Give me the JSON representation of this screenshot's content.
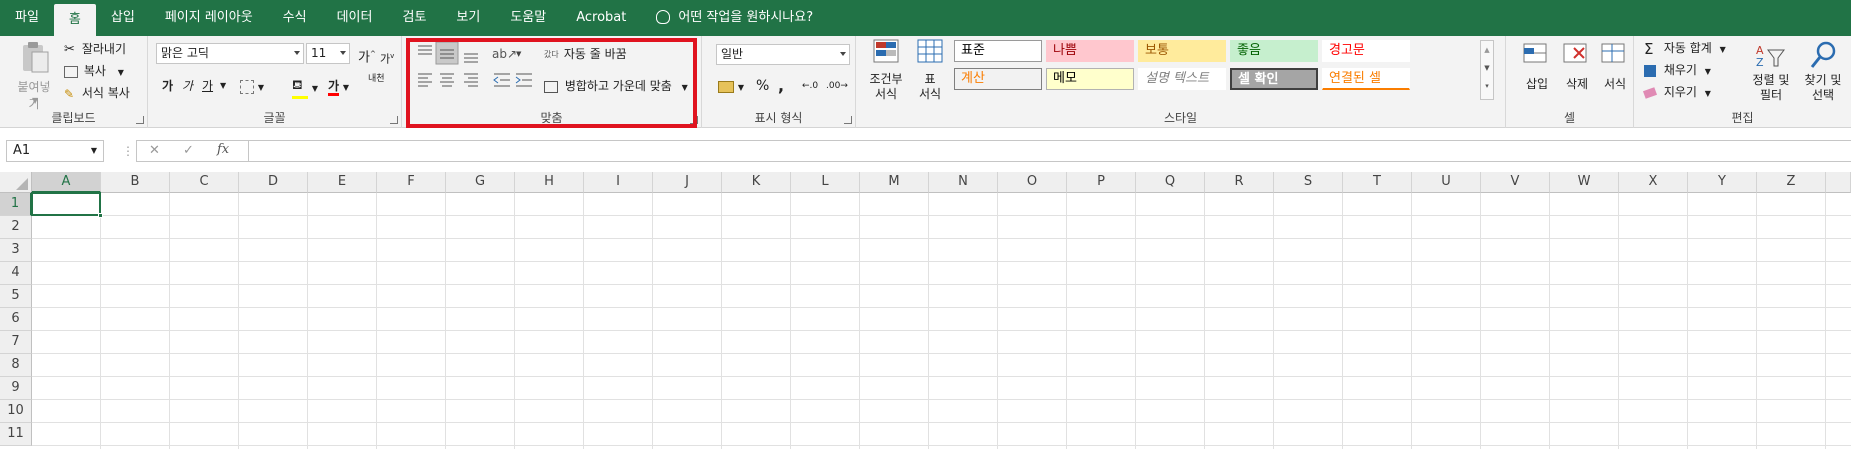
{
  "tabs": [
    "파일",
    "홈",
    "삽입",
    "페이지 레이아웃",
    "수식",
    "데이터",
    "검토",
    "보기",
    "도움말",
    "Acrobat",
    "어떤 작업을 원하시나요?"
  ],
  "active_tab": "홈",
  "clipboard": {
    "paste": "붙여넣기",
    "cut": "잘라내기",
    "copy": "복사",
    "format_painter": "서식 복사",
    "label": "클립보드"
  },
  "font": {
    "name": "맑은 고딕",
    "size": "11",
    "grow": "가",
    "shrink": "가",
    "bold": "가",
    "italic": "가",
    "underline": "가",
    "color_letter": "가",
    "phonetic": "내천",
    "label": "글꼴"
  },
  "alignment": {
    "wrap_text": "자동 줄 바꿈",
    "wrap_icon_text": "갔다",
    "merge_center": "병합하고 가운데 맞춤",
    "label": "맞춤"
  },
  "number": {
    "format": "일반",
    "percent": "%",
    "comma": ",",
    "label": "표시 형식"
  },
  "styles": {
    "conditional": "조건부\n서식",
    "table": "표\n서식",
    "cells": [
      {
        "text": "표준",
        "bg": "#ffffff",
        "fg": "#000000",
        "border": "#9a9a9a"
      },
      {
        "text": "나쁨",
        "bg": "#ffc7ce",
        "fg": "#9c0006",
        "border": "#ffc7ce"
      },
      {
        "text": "보통",
        "bg": "#ffeb9c",
        "fg": "#9c5700",
        "border": "#ffeb9c"
      },
      {
        "text": "좋음",
        "bg": "#c6efce",
        "fg": "#006100",
        "border": "#c6efce"
      },
      {
        "text": "경고문",
        "bg": "#ffffff",
        "fg": "#ff0000",
        "border": "#ffffff"
      },
      {
        "text": "계산",
        "bg": "#f2f2f2",
        "fg": "#fa7d00",
        "border": "#7f7f7f"
      },
      {
        "text": "메모",
        "bg": "#ffffcc",
        "fg": "#000000",
        "border": "#b2b2b2"
      },
      {
        "text": "설명 텍스트",
        "bg": "#ffffff",
        "fg": "#7f7f7f",
        "border": "#ffffff"
      },
      {
        "text": "셀 확인",
        "bg": "#a5a5a5",
        "fg": "#ffffff",
        "border": "#3f3f3f"
      },
      {
        "text": "연결된 셀",
        "bg": "#ffffff",
        "fg": "#fa7d00",
        "border": "#ffffff"
      }
    ],
    "label": "스타일"
  },
  "cells_group": {
    "insert": "삽입",
    "delete": "삭제",
    "format": "서식",
    "label": "셀"
  },
  "editing": {
    "autosum": "자동 합계",
    "fill": "채우기",
    "clear": "지우기",
    "sort_filter": "정렬 및\n필터",
    "find_select": "찾기 및\n선택",
    "label": "편집"
  },
  "formula_bar": {
    "name_box": "A1",
    "cancel": "✕",
    "enter": "✓",
    "fx": "fx"
  },
  "columns": [
    "A",
    "B",
    "C",
    "D",
    "E",
    "F",
    "G",
    "H",
    "I",
    "J",
    "K",
    "L",
    "M",
    "N",
    "O",
    "P",
    "Q",
    "R",
    "S",
    "T",
    "U",
    "V",
    "W",
    "X",
    "Y",
    "Z"
  ],
  "rows": [
    "1",
    "2",
    "3",
    "4",
    "5",
    "6",
    "7",
    "8",
    "9",
    "10",
    "11"
  ],
  "colors": {
    "brand": "#217346",
    "highlight": "#e0131f"
  }
}
